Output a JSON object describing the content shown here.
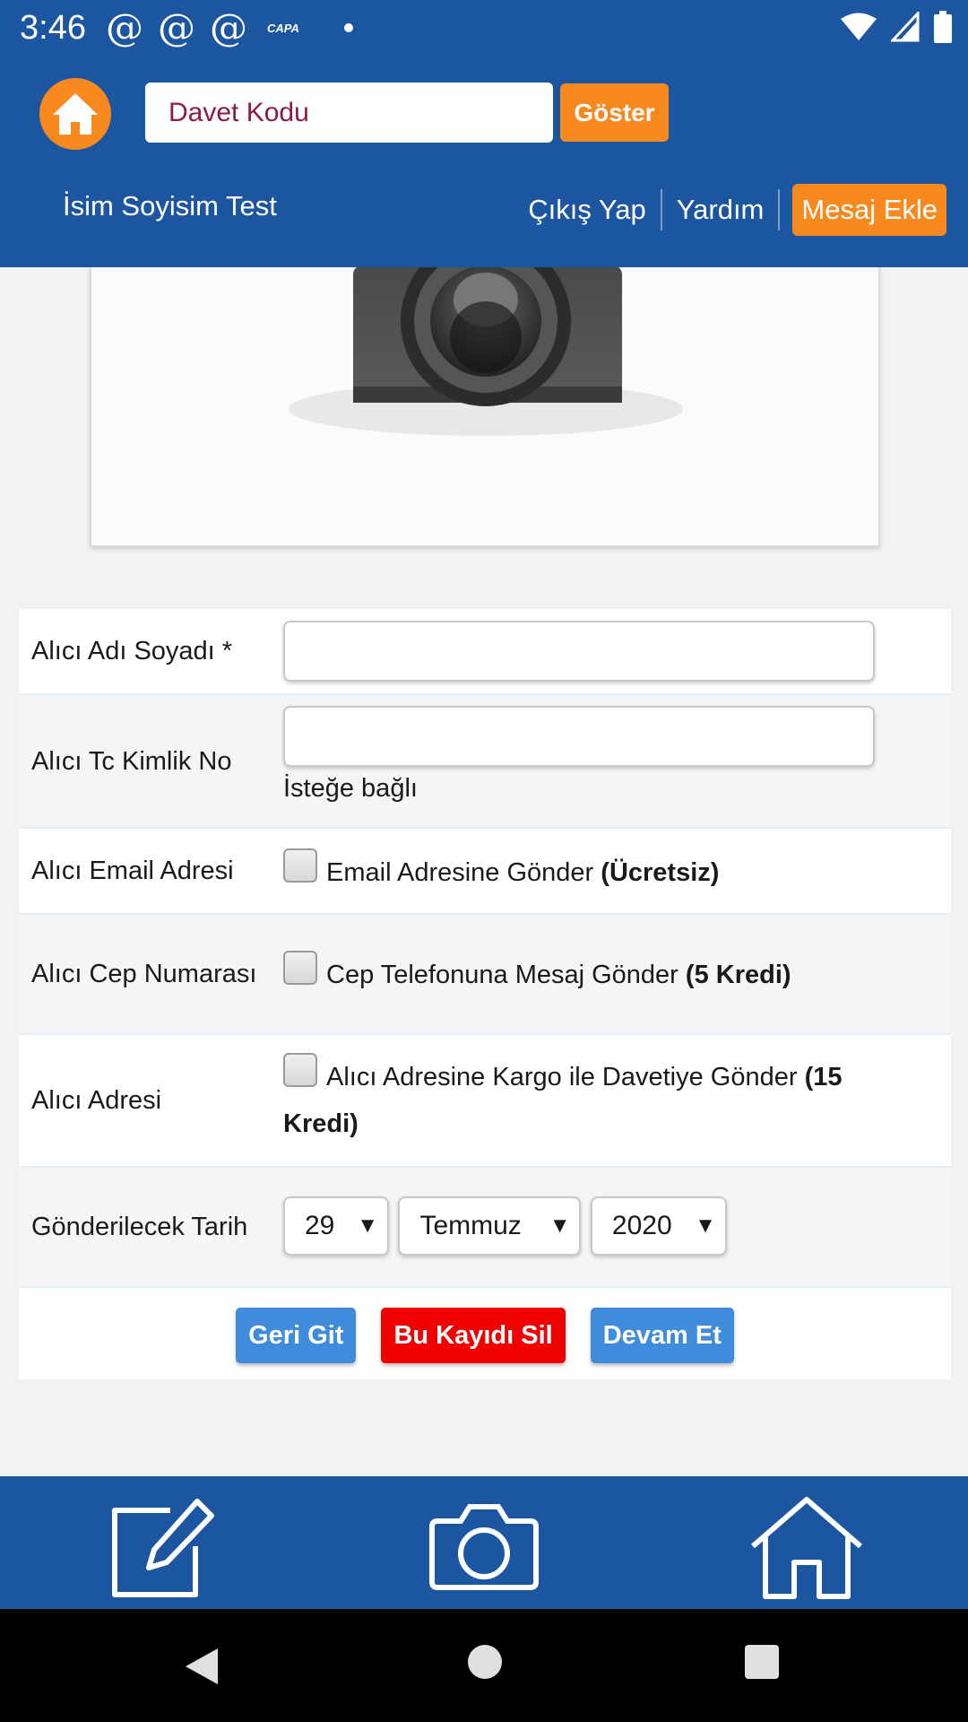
{
  "status_bar": {
    "time": "3:46",
    "notifications": [
      "@",
      "@",
      "@"
    ],
    "capa_label": "CAPA"
  },
  "header": {
    "invite_placeholder": "Davet Kodu",
    "show_button": "Göster",
    "user_name": "İsim Soyisim Test",
    "nav": {
      "logout": "Çıkış Yap",
      "help": "Yardım",
      "add_message": "Mesaj Ekle"
    }
  },
  "form": {
    "recipient_name_label": "Alıcı Adı Soyadı *",
    "recipient_tc_label": "Alıcı Tc Kimlik No",
    "recipient_tc_hint": "İsteğe bağlı",
    "email_label": "Alıcı Email Adresi",
    "email_option": "Email Adresine Gönder",
    "email_option_note": "(Ücretsiz)",
    "phone_label": "Alıcı Cep Numarası",
    "phone_option": "Cep Telefonuna Mesaj Gönder",
    "phone_option_note": "(5 Kredi)",
    "address_label": "Alıcı Adresi",
    "address_option": "Alıcı Adresine Kargo ile Davetiye Gönder",
    "address_option_note": "(15 Kredi)",
    "date_label": "Gönderilecek Tarih",
    "date_day": "29",
    "date_month": "Temmuz",
    "date_year": "2020"
  },
  "buttons": {
    "back": "Geri Git",
    "delete": "Bu Kayıdı Sil",
    "continue": "Devam Et"
  },
  "bottom_nav": [
    "edit-icon",
    "camera-icon",
    "home-icon"
  ]
}
